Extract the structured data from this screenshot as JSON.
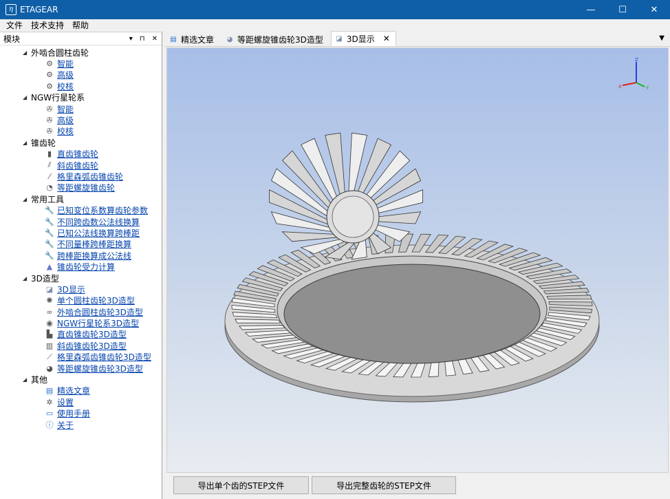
{
  "window": {
    "title": "ETAGEAR",
    "controls": [
      "—",
      "☐",
      "✕"
    ]
  },
  "menu": [
    "文件",
    "技术支持",
    "帮助"
  ],
  "left_panel": {
    "title": "模块",
    "header_icons": [
      "▾",
      "⊓",
      "✕"
    ]
  },
  "tree": [
    {
      "label": "外啮合圆柱齿轮",
      "items": [
        {
          "label": "智能",
          "icon": "gear-pair-icon"
        },
        {
          "label": "高级",
          "icon": "gear-pair-icon"
        },
        {
          "label": "校核",
          "icon": "gear-pair-icon"
        }
      ]
    },
    {
      "label": "NGW行星轮系",
      "items": [
        {
          "label": "智能",
          "icon": "planetary-icon"
        },
        {
          "label": "高级",
          "icon": "planetary-icon"
        },
        {
          "label": "校核",
          "icon": "planetary-icon"
        }
      ]
    },
    {
      "label": "锥齿轮",
      "items": [
        {
          "label": "直齿锥齿轮",
          "icon": "straight-bevel-icon"
        },
        {
          "label": "斜齿锥齿轮",
          "icon": "helical-bevel-icon"
        },
        {
          "label": "格里森弧齿锥齿轮",
          "icon": "gleason-bevel-icon"
        },
        {
          "label": "等距螺旋锥齿轮",
          "icon": "spiral-bevel-icon"
        }
      ]
    },
    {
      "label": "常用工具",
      "items": [
        {
          "label": "已知变位系数算齿轮参数",
          "icon": "wrench-icon"
        },
        {
          "label": "不同跨齿数公法线换算",
          "icon": "wrench-icon"
        },
        {
          "label": "已知公法线换算跨棒距",
          "icon": "wrench-icon"
        },
        {
          "label": "不同量棒跨棒距换算",
          "icon": "wrench-icon"
        },
        {
          "label": "跨棒距换算成公法线",
          "icon": "wrench-icon"
        },
        {
          "label": "锥齿轮受力计算",
          "icon": "force-icon"
        }
      ]
    },
    {
      "label": "3D造型",
      "items": [
        {
          "label": "3D显示",
          "icon": "3d-view-icon"
        },
        {
          "label": "单个圆柱齿轮3D造型",
          "icon": "spur-gear-3d-icon"
        },
        {
          "label": "外啮合圆柱齿轮3D造型",
          "icon": "gear-mesh-3d-icon"
        },
        {
          "label": "NGW行星轮系3D造型",
          "icon": "planetary-3d-icon"
        },
        {
          "label": "直齿锥齿轮3D造型",
          "icon": "straight-bevel-3d-icon"
        },
        {
          "label": "斜齿锥齿轮3D造型",
          "icon": "helical-bevel-3d-icon"
        },
        {
          "label": "格里森弧齿锥齿轮3D造型",
          "icon": "gleason-3d-icon"
        },
        {
          "label": "等距螺旋锥齿轮3D造型",
          "icon": "spiral-bevel-3d-icon"
        }
      ]
    },
    {
      "label": "其他",
      "items": [
        {
          "label": "精选文章",
          "icon": "document-icon"
        },
        {
          "label": "设置",
          "icon": "settings-icon"
        },
        {
          "label": "使用手册",
          "icon": "manual-icon"
        },
        {
          "label": "关于",
          "icon": "info-icon"
        }
      ]
    }
  ],
  "tabs": [
    {
      "label": "精选文章",
      "icon": "document-icon",
      "active": false
    },
    {
      "label": "等距螺旋锥齿轮3D造型",
      "icon": "spiral-bevel-icon",
      "active": false
    },
    {
      "label": "3D显示",
      "icon": "3d-view-icon",
      "active": true
    }
  ],
  "viewport": {
    "axis_labels": {
      "z": "Z",
      "x": "X",
      "y": "Y"
    },
    "colors": {
      "x": "#e02020",
      "y": "#20b020",
      "z": "#2040e0"
    }
  },
  "buttons": {
    "export_single": "导出单个齿的STEP文件",
    "export_full": "导出完整齿轮的STEP文件"
  }
}
